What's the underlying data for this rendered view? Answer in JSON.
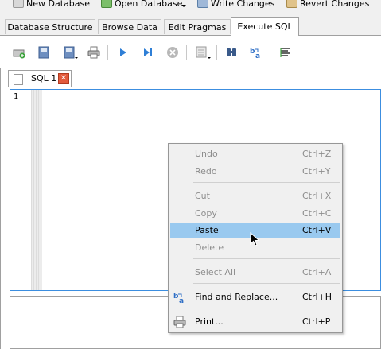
{
  "main_toolbar": {
    "new_database": "New Database",
    "open_database": "Open Database",
    "write_changes": "Write Changes",
    "revert_changes": "Revert Changes"
  },
  "tabs": [
    {
      "label": "Database Structure"
    },
    {
      "label": "Browse Data"
    },
    {
      "label": "Edit Pragmas"
    },
    {
      "label": "Execute SQL"
    }
  ],
  "editor_tab": {
    "label": "SQL 1",
    "close_glyph": "✕"
  },
  "editor": {
    "line_number": "1"
  },
  "context_menu": {
    "items": [
      {
        "label": "Undo",
        "shortcut": "Ctrl+Z",
        "enabled": false
      },
      {
        "label": "Redo",
        "shortcut": "Ctrl+Y",
        "enabled": false
      },
      {
        "label": "Cut",
        "shortcut": "Ctrl+X",
        "enabled": false
      },
      {
        "label": "Copy",
        "shortcut": "Ctrl+C",
        "enabled": false
      },
      {
        "label": "Paste",
        "shortcut": "Ctrl+V",
        "enabled": true,
        "highlighted": true
      },
      {
        "label": "Delete",
        "shortcut": "",
        "enabled": false
      },
      {
        "label": "Select All",
        "shortcut": "Ctrl+A",
        "enabled": false
      },
      {
        "label": "Find and Replace...",
        "shortcut": "Ctrl+H",
        "enabled": true,
        "icon": "find-replace-icon"
      },
      {
        "label": "Print...",
        "shortcut": "Ctrl+P",
        "enabled": true,
        "icon": "printer-icon"
      }
    ]
  },
  "colors": {
    "accent_border": "#3c8ee0",
    "menu_highlight": "#99c9ef",
    "close_button": "#e25a3c",
    "disabled_text": "#8d8d8d"
  }
}
